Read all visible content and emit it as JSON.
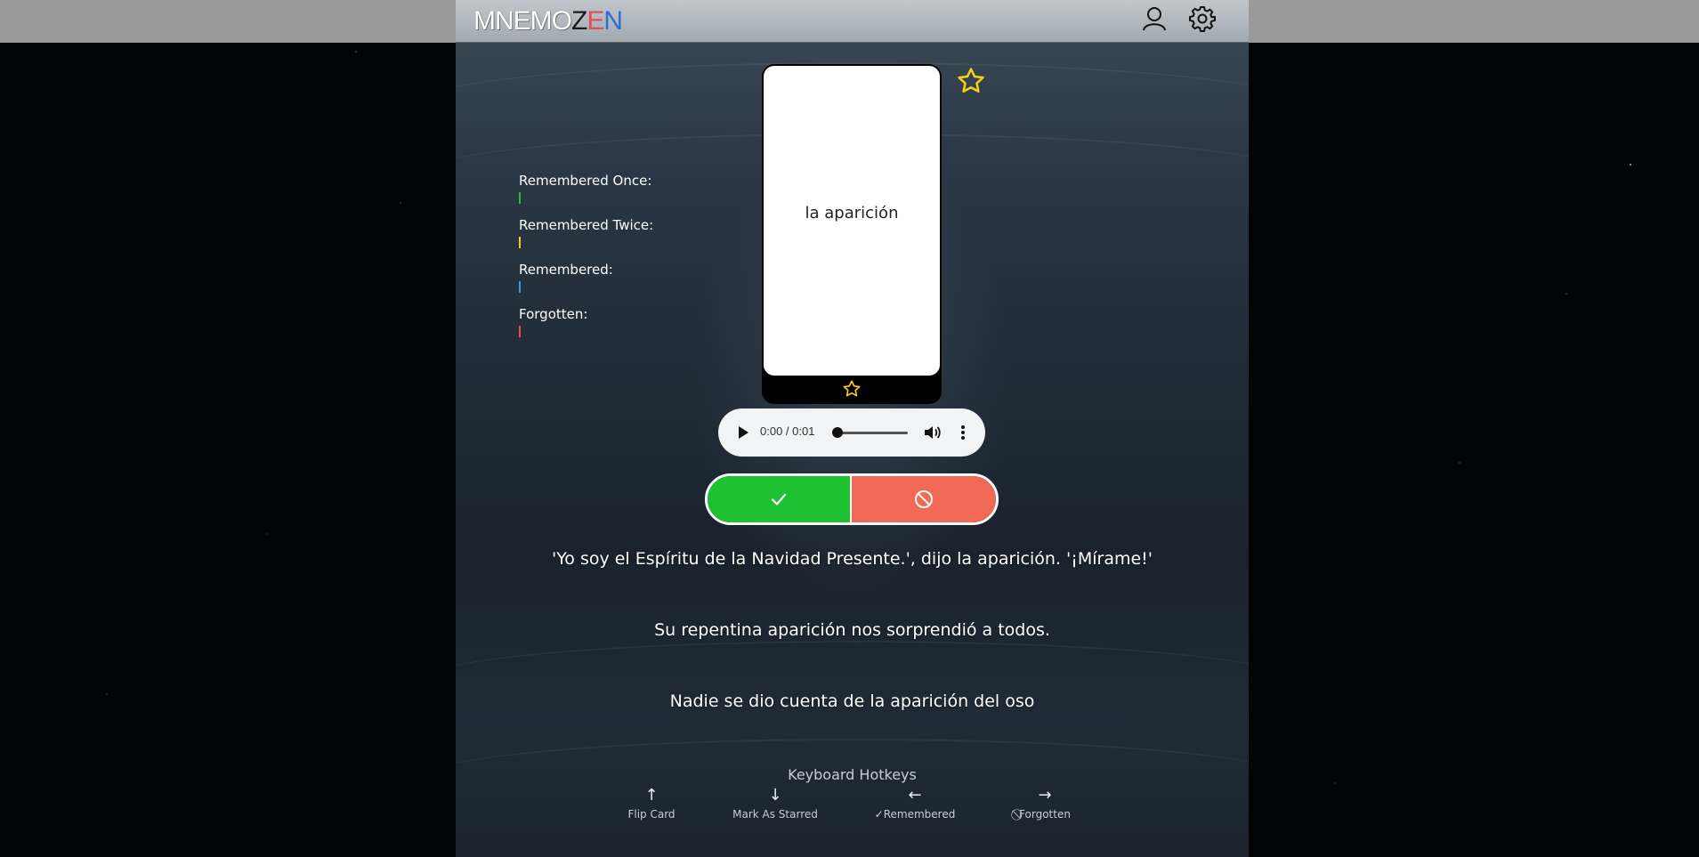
{
  "header": {
    "logo_prefix": "MNEMO",
    "logo_z": "Z",
    "logo_e": "E",
    "logo_n": "N",
    "icons": [
      "user-icon",
      "gear-icon"
    ]
  },
  "stats": [
    {
      "label": "Remembered Once:",
      "color": "#1dc131"
    },
    {
      "label": "Remembered Twice:",
      "color": "#f3d116"
    },
    {
      "label": "Remembered:",
      "color": "#2d9bf0"
    },
    {
      "label": "Forgotten:",
      "color": "#f04b4b"
    }
  ],
  "card": {
    "word": "la aparición"
  },
  "audio": {
    "time": "0:00 / 0:01",
    "progress": 0
  },
  "answer": {
    "remembered_icon": "check-icon",
    "forgotten_icon": "ban-icon"
  },
  "sentences": [
    "'Yo soy el Espíritu de la Navidad Presente.', dijo la aparición. '¡Mírame!'",
    "Su repentina aparición nos sorprendió a todos.",
    "Nadie se dio cuenta de la aparición del oso"
  ],
  "hotkeys": {
    "title": "Keyboard Hotkeys",
    "items": [
      {
        "arrow": "↑",
        "label": "Flip Card"
      },
      {
        "arrow": "↓",
        "label": "Mark As Starred"
      },
      {
        "arrow": "←",
        "label": "✓Remembered"
      },
      {
        "arrow": "→",
        "label": "⃠Forgotten"
      }
    ]
  },
  "colors": {
    "remembered_button": "#1dc131",
    "forgotten_button": "#f26a55",
    "star": "#f3d116"
  }
}
